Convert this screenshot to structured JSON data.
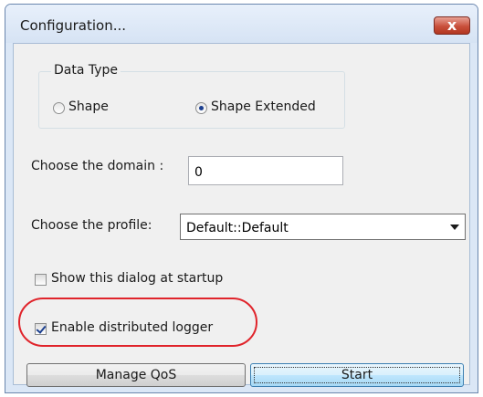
{
  "window": {
    "title": "Configuration...",
    "close_label": "x"
  },
  "data_type": {
    "group_label": "Data Type",
    "options": [
      {
        "label": "Shape",
        "selected": false
      },
      {
        "label": "Shape Extended",
        "selected": true
      }
    ]
  },
  "domain": {
    "label": "Choose the domain :",
    "value": "0"
  },
  "profile": {
    "label": "Choose the profile:",
    "selected": "Default::Default"
  },
  "options": {
    "show_dialog_label": "Show this dialog at startup",
    "show_dialog_checked": false,
    "distributed_logger_label": "Enable distributed logger",
    "distributed_logger_checked": true
  },
  "buttons": {
    "manage_qos": "Manage QoS",
    "start": "Start"
  },
  "colors": {
    "highlight": "#e0242b",
    "close_button": "#c9503b"
  }
}
